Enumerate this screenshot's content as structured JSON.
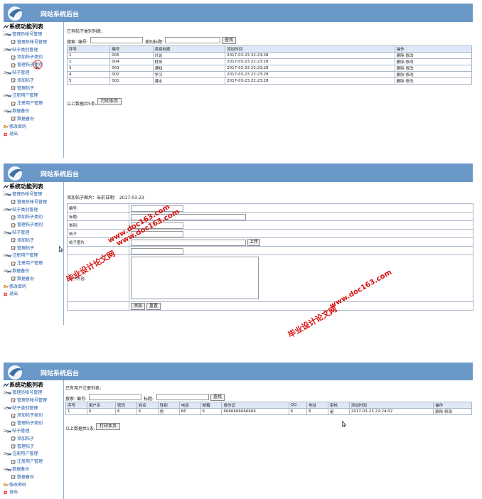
{
  "site_title": "网站系统后台",
  "sidebar": {
    "title": "系统功能列表",
    "items": [
      {
        "label": "管理员帐号管理",
        "level": "top"
      },
      {
        "label": "管理员帐号管理",
        "level": "sub"
      },
      {
        "label": "帖子类别管理",
        "level": "top"
      },
      {
        "label": "添加帖子类别",
        "level": "sub"
      },
      {
        "label": "管理帖子类别",
        "level": "sub"
      },
      {
        "label": "帖子管理",
        "level": "top"
      },
      {
        "label": "添加帖子",
        "level": "sub"
      },
      {
        "label": "管理帖子",
        "level": "sub"
      },
      {
        "label": "注册用户管理",
        "level": "top"
      },
      {
        "label": "注册用户管理",
        "level": "sub"
      },
      {
        "label": "数据备份",
        "level": "top"
      },
      {
        "label": "数据备份",
        "level": "sub"
      },
      {
        "label": "修改密码",
        "level": "single"
      },
      {
        "label": "退出",
        "level": "single"
      }
    ]
  },
  "panel1": {
    "heading": "已有帖子类别列表：",
    "search_label": "搜索: 编号:",
    "title_label": "类别标题:",
    "search_button": "查找",
    "columns": [
      "序号",
      "编号",
      "类别标题",
      "添加时间",
      "操作"
    ],
    "rows": [
      [
        "1",
        "005",
        "讨论",
        "2017-03-23 22:23:28",
        "删除 修改"
      ],
      [
        "2",
        "004",
        "财务",
        "2017-03-23 22:23:28",
        "删除 修改"
      ],
      [
        "3",
        "003",
        "通知",
        "2017-03-23 22:23:28",
        "删除 修改"
      ],
      [
        "4",
        "002",
        "学习",
        "2017-03-23 22:23:28",
        "删除 修改"
      ],
      [
        "5",
        "001",
        "灌水",
        "2017-03-23 22:23:28",
        "删除 修改"
      ]
    ],
    "total_text": "以上数据共5条。",
    "print_button": "打印本页"
  },
  "panel2": {
    "top_text": "",
    "heading": "添加帖子图片：",
    "date_text": "当前日期：  2017-03-23",
    "fields": [
      "编号:",
      "标题:",
      "类别:",
      "帖子",
      "帖子图片:",
      "",
      "帖子内容:"
    ],
    "upload_button": "上传",
    "add_button": "添加",
    "reset_button": "重置"
  },
  "panel3": {
    "heading": "已有用户注册列表：",
    "search_label": "搜索: 编号:",
    "title_label": "标题:",
    "search_button": "查找",
    "columns": [
      "序号",
      "用户名",
      "密码",
      "姓名",
      "性别",
      "电话",
      "邮箱",
      "身份证",
      "QQ",
      "地址",
      "审核",
      "添加时间",
      "操作"
    ],
    "rows": [
      [
        "1",
        "6",
        "6",
        "6",
        "男",
        "66",
        "6",
        "6666666666666",
        "6",
        "6",
        "是",
        "2017-03-23 22:24:02",
        "删除 修改"
      ]
    ],
    "total_text": "以上数据共1条。",
    "print_button": "打印本页"
  },
  "watermarks": [
    "www.doc163.com",
    "毕业设计论文网",
    "www.doc163.com",
    "毕业设计论文网",
    "www.doc163.com"
  ]
}
